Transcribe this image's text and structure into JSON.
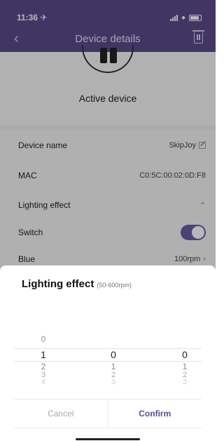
{
  "status_bar": {
    "time": "11:36 ✈",
    "signal": "signal-icon",
    "wifi": "wifi-icon",
    "battery": "battery-icon"
  },
  "nav": {
    "back_glyph": "‹",
    "title": "Device details",
    "delete_icon": "trash-icon"
  },
  "device": {
    "status": "Active device"
  },
  "details": [
    {
      "label": "Device name",
      "value": "SkipJoy"
    },
    {
      "label": "MAC",
      "value": "C0:5C:00:02:0D:F8"
    }
  ],
  "lighting_section": {
    "label": "Lighting effect",
    "collapse_glyph": "⌃"
  },
  "switch_row": {
    "label": "Switch",
    "on": true
  },
  "blue_row": {
    "label": "Blue",
    "value": "100rpm",
    "chevron": "›"
  },
  "sheet": {
    "title": "Lighting effect",
    "range": "(50-600rpm)",
    "picker": {
      "columns": [
        {
          "above": "0",
          "selected": "1",
          "below": [
            "2",
            "3",
            "4"
          ]
        },
        {
          "above": "",
          "selected": "0",
          "below": [
            "1",
            "2",
            "3"
          ]
        },
        {
          "above": "",
          "selected": "0",
          "below": [
            "1",
            "2",
            "3"
          ]
        }
      ]
    },
    "cancel_label": "Cancel",
    "confirm_label": "Confirm"
  },
  "colors": {
    "header": "#5a4c8a",
    "accent": "#6a5ca4"
  }
}
